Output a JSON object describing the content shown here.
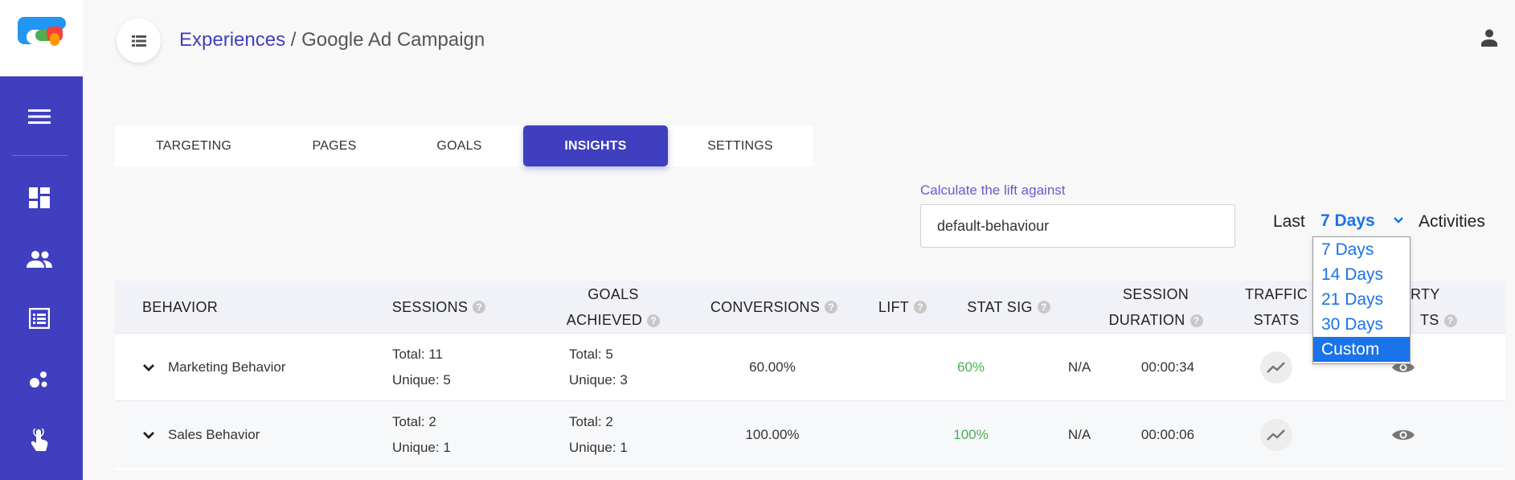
{
  "header": {
    "breadcrumb_link": "Experiences",
    "breadcrumb_sep": " / ",
    "breadcrumb_current": "Google Ad Campaign"
  },
  "tabs": [
    {
      "label": "TARGETING",
      "active": false
    },
    {
      "label": "PAGES",
      "active": false
    },
    {
      "label": "GOALS",
      "active": false
    },
    {
      "label": "INSIGHTS",
      "active": true
    },
    {
      "label": "SETTINGS",
      "active": false
    }
  ],
  "lift": {
    "label": "Calculate the lift against",
    "value": "default-behaviour"
  },
  "period": {
    "prefix": "Last",
    "selected": "7 Days",
    "suffix": "Activities",
    "options": [
      "7 Days",
      "14 Days",
      "21 Days",
      "30 Days",
      "Custom"
    ],
    "highlighted": "Custom"
  },
  "table": {
    "headers": {
      "behavior": "BEHAVIOR",
      "sessions": "SESSIONS",
      "goals_1": "GOALS",
      "goals_2": "ACHIEVED",
      "conversions": "CONVERSIONS",
      "lift": "LIFT",
      "stat_sig": "STAT SIG",
      "duration_1": "SESSION",
      "duration_2": "DURATION",
      "traffic_1": "TRAFFIC",
      "traffic_2": "STATS",
      "third_1": "RTY",
      "third_2": "TS"
    },
    "rows": [
      {
        "behavior": "Marketing Behavior",
        "sessions_total": "Total: 11",
        "sessions_unique": "Unique: 5",
        "goals_total": "Total: 5",
        "goals_unique": "Unique: 3",
        "conversions": "60.00%",
        "lift": "60%",
        "stat_sig": "N/A",
        "duration": "00:00:34"
      },
      {
        "behavior": "Sales Behavior",
        "sessions_total": "Total: 2",
        "sessions_unique": "Unique: 1",
        "goals_total": "Total: 2",
        "goals_unique": "Unique: 1",
        "conversions": "100.00%",
        "lift": "100%",
        "stat_sig": "N/A",
        "duration": "00:00:06"
      }
    ]
  },
  "colors": {
    "brand": "#3f3fbf",
    "link_blue": "#1a73e8",
    "lift_green": "#4caf50"
  }
}
